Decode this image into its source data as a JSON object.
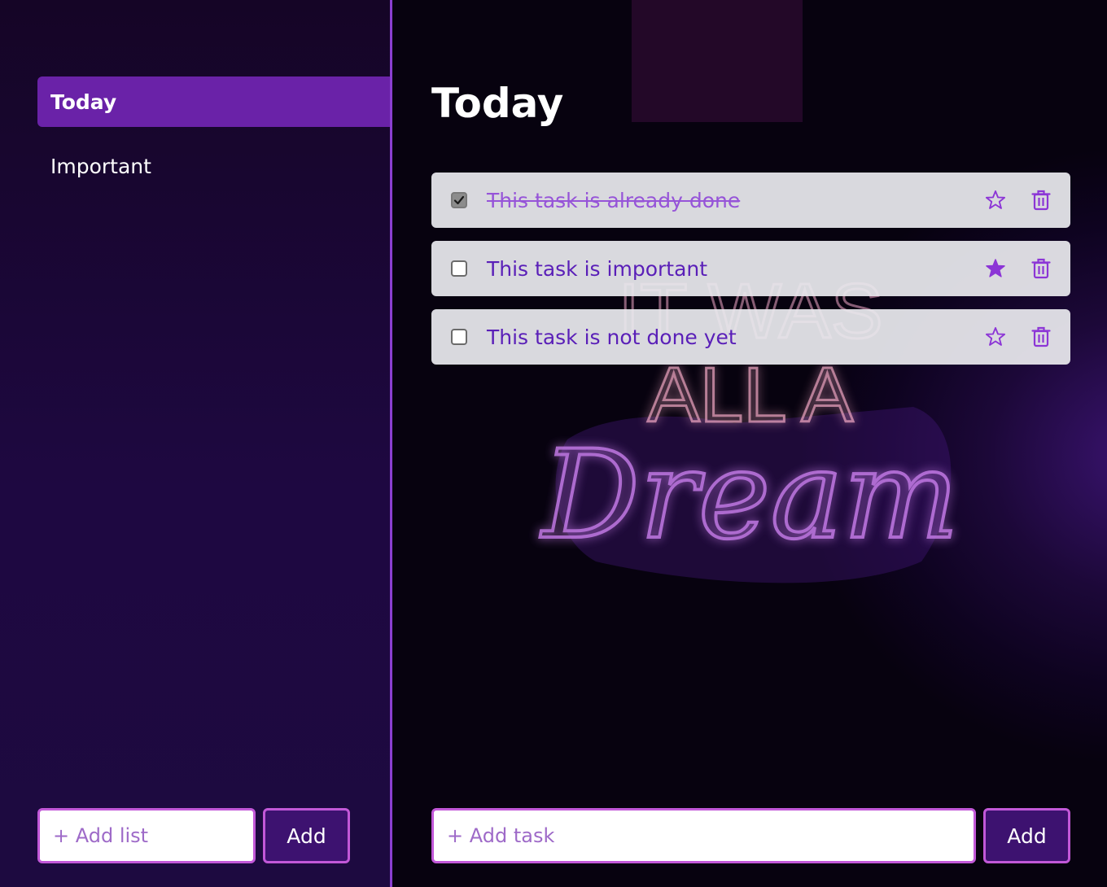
{
  "sidebar": {
    "items": [
      {
        "label": "Today",
        "active": true
      },
      {
        "label": "Important",
        "active": false
      }
    ],
    "add_list": {
      "placeholder": "+ Add list",
      "button_label": "Add"
    }
  },
  "main": {
    "title": "Today",
    "tasks": [
      {
        "text": "This task is already done",
        "done": true,
        "important": false
      },
      {
        "text": "This task is important",
        "done": false,
        "important": true
      },
      {
        "text": "This task is not done yet",
        "done": false,
        "important": false
      }
    ],
    "add_task": {
      "placeholder": "+ Add task",
      "button_label": "Add"
    }
  },
  "background_sign": {
    "line1": "IT WAS",
    "line2": "ALL A",
    "line3": "Dream"
  },
  "icons": {
    "check": "check-icon",
    "star_filled": "star-filled-icon",
    "star_outline": "star-outline-icon",
    "trash": "trash-icon"
  },
  "colors": {
    "accent": "#6a22a8",
    "border_accent": "#c258d8",
    "sidebar_border": "#8a3fd0",
    "task_text": "#5a1fb8",
    "icon": "#8c35d6",
    "button_bg": "#3d1270"
  }
}
